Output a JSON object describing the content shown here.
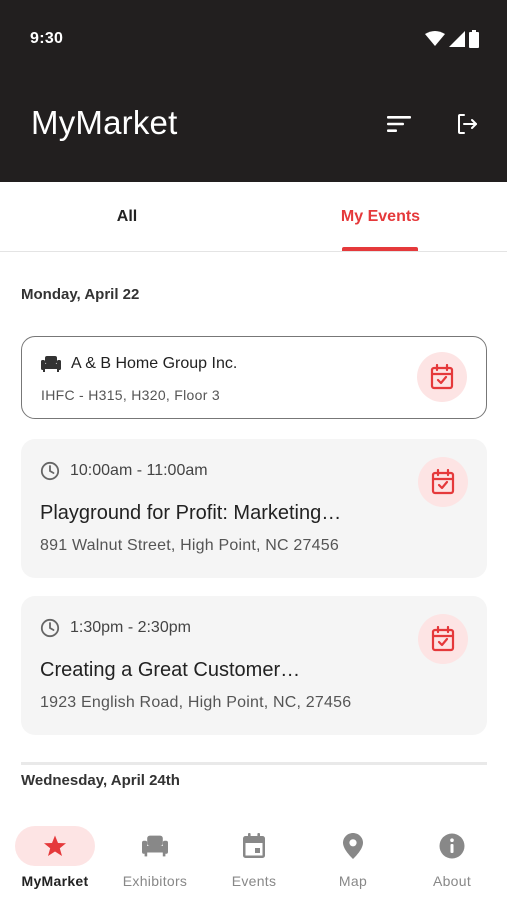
{
  "status_bar": {
    "time": "9:30"
  },
  "app_bar": {
    "title": "MyMarket"
  },
  "tabs": [
    {
      "label": "All",
      "active": false
    },
    {
      "label": "My Events",
      "active": true
    }
  ],
  "sections": [
    {
      "date": "Monday, April 22",
      "items": [
        {
          "kind": "exhibitor",
          "name": "A & B Home Group Inc.",
          "location": "IHFC - H315, H320, Floor 3"
        },
        {
          "kind": "event",
          "time": "10:00am - 11:00am",
          "title": "Playground for Profit: Marketing…",
          "address": "891 Walnut Street, High Point, NC 27456"
        },
        {
          "kind": "event",
          "time": "1:30pm - 2:30pm",
          "title": "Creating a Great Customer…",
          "address": "1923 English Road, High Point, NC, 27456"
        }
      ]
    },
    {
      "date": "Wednesday, April 24th",
      "items": []
    }
  ],
  "bottom_nav": [
    {
      "label": "MyMarket",
      "icon": "star-icon",
      "active": true
    },
    {
      "label": "Exhibitors",
      "icon": "armchair-icon",
      "active": false
    },
    {
      "label": "Events",
      "icon": "calendar-icon",
      "active": false
    },
    {
      "label": "Map",
      "icon": "map-pin-icon",
      "active": false
    },
    {
      "label": "About",
      "icon": "info-icon",
      "active": false
    }
  ],
  "colors": {
    "accent": "#e5393b",
    "header_bg": "#221f1f",
    "card_bg": "#f5f5f5",
    "pill_bg": "#fde4e4"
  }
}
